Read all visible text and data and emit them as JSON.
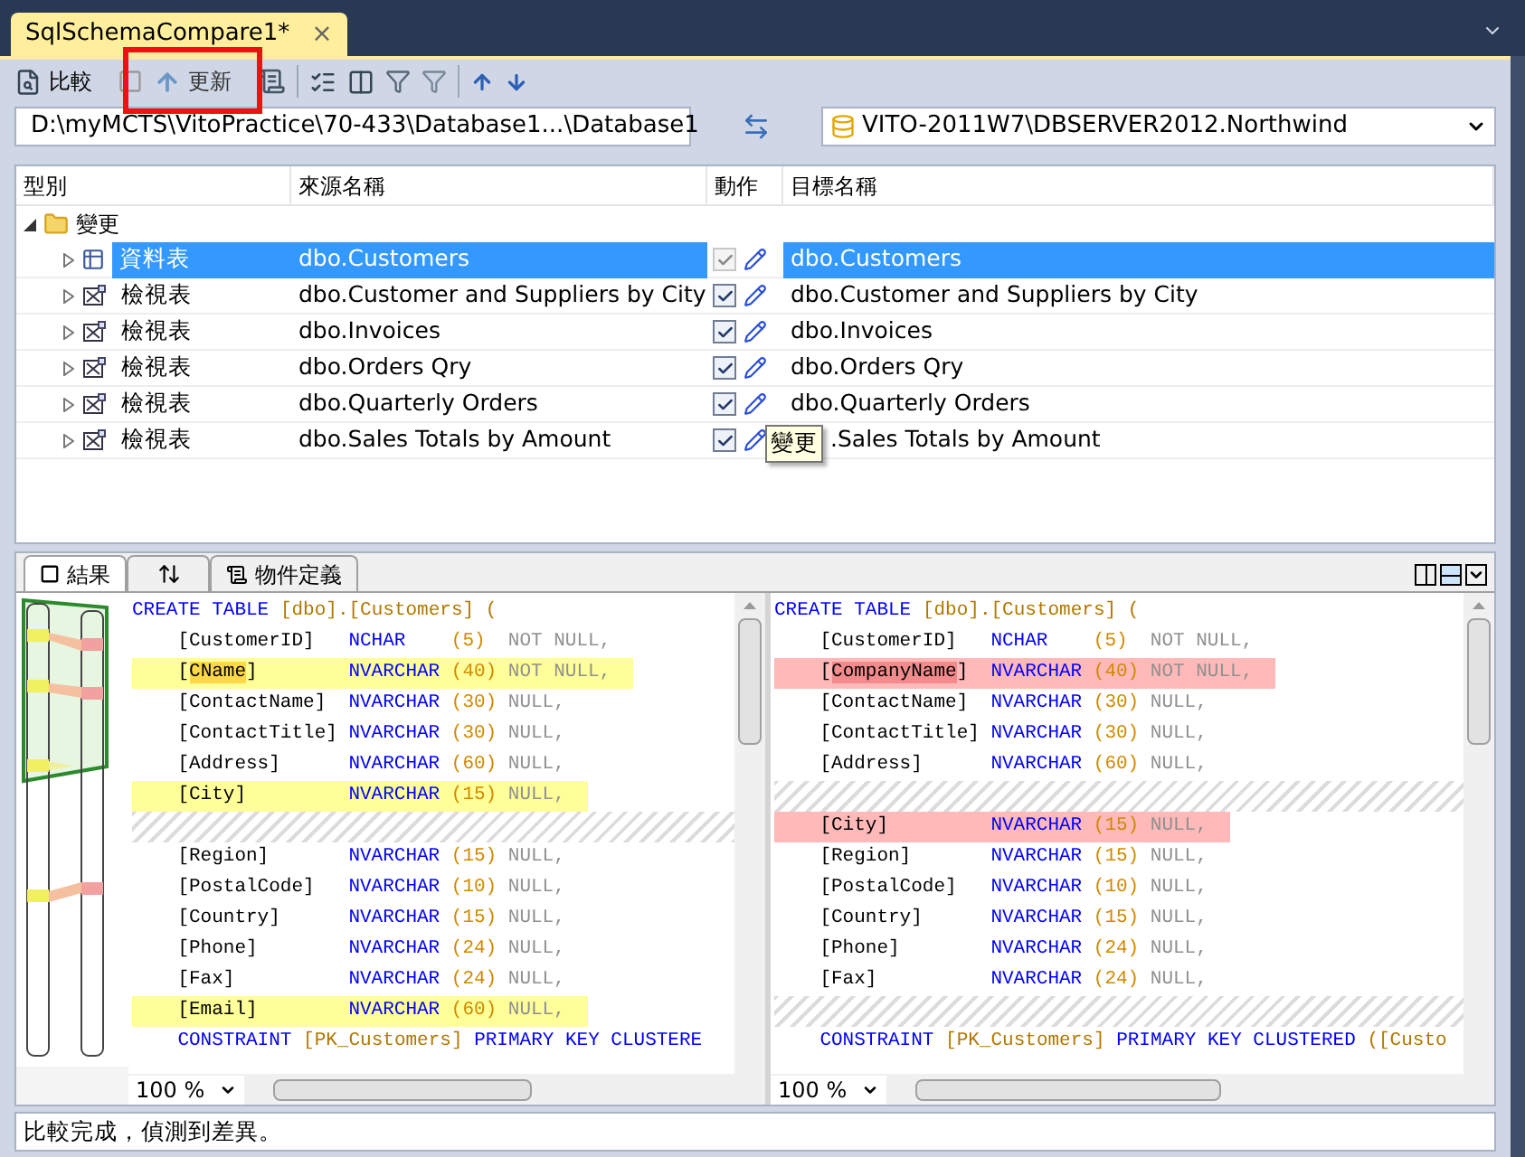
{
  "tab": {
    "title": "SqlSchemaCompare1*",
    "close": "×"
  },
  "toolbar": {
    "compare": "比較",
    "update": "更新"
  },
  "source_path": "D:\\myMCTS\\VitoPractice\\70-433\\Database1...\\Database1",
  "target_path": "VITO-2011W7\\DBSERVER2012.Northwind",
  "grid": {
    "columns": [
      "型別",
      "來源名稱",
      "動作",
      "目標名稱"
    ],
    "group": {
      "label": "變更",
      "expanded": true,
      "rows": [
        {
          "kind": "table",
          "type": "資料表",
          "source": "dbo.Customers",
          "checked": true,
          "disabled": true,
          "target": "dbo.Customers",
          "selected": true
        },
        {
          "kind": "view",
          "type": "檢視表",
          "source": "dbo.Customer and Suppliers by City",
          "checked": true,
          "disabled": false,
          "target": "dbo.Customer and Suppliers by City",
          "selected": false
        },
        {
          "kind": "view",
          "type": "檢視表",
          "source": "dbo.Invoices",
          "checked": true,
          "disabled": false,
          "target": "dbo.Invoices",
          "selected": false
        },
        {
          "kind": "view",
          "type": "檢視表",
          "source": "dbo.Orders Qry",
          "checked": true,
          "disabled": false,
          "target": "dbo.Orders Qry",
          "selected": false
        },
        {
          "kind": "view",
          "type": "檢視表",
          "source": "dbo.Quarterly Orders",
          "checked": true,
          "disabled": false,
          "target": "dbo.Quarterly Orders",
          "selected": false
        },
        {
          "kind": "view",
          "type": "檢視表",
          "source": "dbo.Sales Totals by Amount",
          "checked": true,
          "disabled": false,
          "tooltip": "變更",
          "target": ".Sales Totals by Amount",
          "selected": false
        }
      ]
    }
  },
  "bottom_tabs": [
    {
      "kind": "results",
      "label": "結果",
      "selected": true
    },
    {
      "kind": "sort",
      "selected": false
    },
    {
      "kind": "definition",
      "label": "物件定義",
      "selected": false
    }
  ],
  "scripts": [
    {
      "kind": "source",
      "zoom": "100 %",
      "lines": [
        {
          "kind": "create",
          "keyword": "CREATE TABLE",
          "object": "[dbo].[Customers] ("
        },
        {
          "kind": "column",
          "name": "[CustomerID]",
          "type": "NCHAR",
          "size": "(5)",
          "nullability": "NOT NULL,",
          "changed": false,
          "name_changed": false
        },
        {
          "kind": "column",
          "name": "[CName]",
          "type": "NVARCHAR",
          "size": "(40)",
          "nullability": "NOT NULL,",
          "changed": true,
          "name_changed": true
        },
        {
          "kind": "column",
          "name": "[ContactName]",
          "type": "NVARCHAR",
          "size": "(30)",
          "nullability": "NULL,",
          "changed": false,
          "name_changed": false
        },
        {
          "kind": "column",
          "name": "[ContactTitle]",
          "type": "NVARCHAR",
          "size": "(30)",
          "nullability": "NULL,",
          "changed": false,
          "name_changed": false
        },
        {
          "kind": "column",
          "name": "[Address]",
          "type": "NVARCHAR",
          "size": "(60)",
          "nullability": "NULL,",
          "changed": false,
          "name_changed": false
        },
        {
          "kind": "column",
          "name": "[City]",
          "type": "NVARCHAR",
          "size": "(15)",
          "nullability": "NULL,",
          "changed": true,
          "name_changed": false
        },
        {
          "kind": "gap"
        },
        {
          "kind": "column",
          "name": "[Region]",
          "type": "NVARCHAR",
          "size": "(15)",
          "nullability": "NULL,",
          "changed": false,
          "name_changed": false
        },
        {
          "kind": "column",
          "name": "[PostalCode]",
          "type": "NVARCHAR",
          "size": "(10)",
          "nullability": "NULL,",
          "changed": false,
          "name_changed": false
        },
        {
          "kind": "column",
          "name": "[Country]",
          "type": "NVARCHAR",
          "size": "(15)",
          "nullability": "NULL,",
          "changed": false,
          "name_changed": false
        },
        {
          "kind": "column",
          "name": "[Phone]",
          "type": "NVARCHAR",
          "size": "(24)",
          "nullability": "NULL,",
          "changed": false,
          "name_changed": false
        },
        {
          "kind": "column",
          "name": "[Fax]",
          "type": "NVARCHAR",
          "size": "(24)",
          "nullability": "NULL,",
          "changed": false,
          "name_changed": false
        },
        {
          "kind": "column",
          "name": "[Email]",
          "type": "NVARCHAR",
          "size": "(60)",
          "nullability": "NULL,",
          "changed": true,
          "name_changed": false
        },
        {
          "kind": "constraint",
          "keyword": "CONSTRAINT",
          "object": "[PK_Customers]",
          "rest": "PRIMARY KEY CLUSTERE"
        }
      ]
    },
    {
      "kind": "target",
      "zoom": "100 %",
      "lines": [
        {
          "kind": "create",
          "keyword": "CREATE TABLE",
          "object": "[dbo].[Customers] ("
        },
        {
          "kind": "column",
          "name": "[CustomerID]",
          "type": "NCHAR",
          "size": "(5)",
          "nullability": "NOT NULL,",
          "changed": false,
          "name_changed": false
        },
        {
          "kind": "column",
          "name": "[CompanyName]",
          "type": "NVARCHAR",
          "size": "(40)",
          "nullability": "NOT NULL,",
          "changed": true,
          "name_changed": true
        },
        {
          "kind": "column",
          "name": "[ContactName]",
          "type": "NVARCHAR",
          "size": "(30)",
          "nullability": "NULL,",
          "changed": false,
          "name_changed": false
        },
        {
          "kind": "column",
          "name": "[ContactTitle]",
          "type": "NVARCHAR",
          "size": "(30)",
          "nullability": "NULL,",
          "changed": false,
          "name_changed": false
        },
        {
          "kind": "column",
          "name": "[Address]",
          "type": "NVARCHAR",
          "size": "(60)",
          "nullability": "NULL,",
          "changed": false,
          "name_changed": false
        },
        {
          "kind": "gap"
        },
        {
          "kind": "column",
          "name": "[City]",
          "type": "NVARCHAR",
          "size": "(15)",
          "nullability": "NULL,",
          "changed": true,
          "name_changed": false
        },
        {
          "kind": "column",
          "name": "[Region]",
          "type": "NVARCHAR",
          "size": "(15)",
          "nullability": "NULL,",
          "changed": false,
          "name_changed": false
        },
        {
          "kind": "column",
          "name": "[PostalCode]",
          "type": "NVARCHAR",
          "size": "(10)",
          "nullability": "NULL,",
          "changed": false,
          "name_changed": false
        },
        {
          "kind": "column",
          "name": "[Country]",
          "type": "NVARCHAR",
          "size": "(15)",
          "nullability": "NULL,",
          "changed": false,
          "name_changed": false
        },
        {
          "kind": "column",
          "name": "[Phone]",
          "type": "NVARCHAR",
          "size": "(24)",
          "nullability": "NULL,",
          "changed": false,
          "name_changed": false
        },
        {
          "kind": "column",
          "name": "[Fax]",
          "type": "NVARCHAR",
          "size": "(24)",
          "nullability": "NULL,",
          "changed": false,
          "name_changed": false
        },
        {
          "kind": "gap"
        },
        {
          "kind": "constraint",
          "keyword": "CONSTRAINT",
          "object": "[PK_Customers]",
          "rest": "PRIMARY KEY CLUSTERED",
          "tail": "([Custo"
        }
      ]
    }
  ],
  "status": "比較完成，偵測到差異。"
}
